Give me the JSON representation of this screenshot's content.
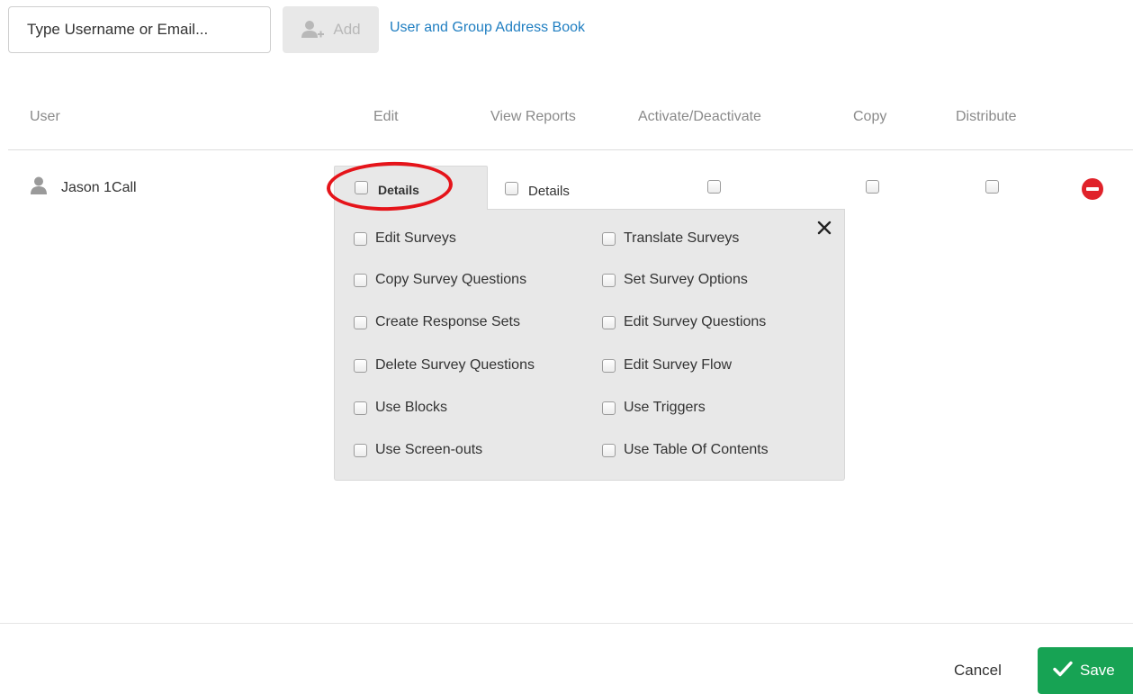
{
  "toolbar": {
    "search_placeholder": "Type Username or Email...",
    "add_label": "Add",
    "address_book_link": "User and Group Address Book"
  },
  "table": {
    "columns": [
      "User",
      "Edit",
      "View Reports",
      "Activate/Deactivate",
      "Copy",
      "Distribute"
    ],
    "rows": [
      {
        "user_name": "Jason 1Call",
        "edit_details_label": "Details",
        "view_reports_details_label": "Details"
      }
    ]
  },
  "edit_details_panel": {
    "left_column": [
      "Edit Surveys",
      "Copy Survey Questions",
      "Create Response Sets",
      "Delete Survey Questions",
      "Use Blocks",
      "Use Screen-outs"
    ],
    "right_column": [
      "Translate Surveys",
      "Set Survey Options",
      "Edit Survey Questions",
      "Edit Survey Flow",
      "Use Triggers",
      "Use Table Of Contents"
    ]
  },
  "footer": {
    "cancel_label": "Cancel",
    "save_label": "Save"
  },
  "colors": {
    "link": "#1f7ec1",
    "save_green": "#17a354",
    "remove_red": "#e0222a",
    "highlight_red": "#e5141a",
    "panel_bg": "#e8e8e8"
  }
}
